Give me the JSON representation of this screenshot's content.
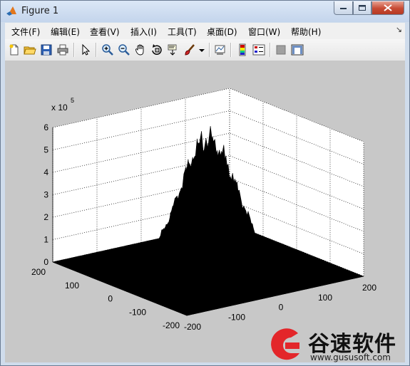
{
  "window": {
    "title": "Figure 1",
    "icon": "matlab-logo-icon"
  },
  "menu": {
    "items": [
      "文件(F)",
      "编辑(E)",
      "查看(V)",
      "插入(I)",
      "工具(T)",
      "桌面(D)",
      "窗口(W)",
      "帮助(H)"
    ],
    "overflow_icon": "menu-overflow-arrow-icon"
  },
  "toolbar": {
    "icons": [
      "new-figure-icon",
      "open-file-icon",
      "save-icon",
      "print-icon",
      "select-arrow-icon",
      "zoom-in-icon",
      "zoom-out-icon",
      "pan-hand-icon",
      "rotate-3d-icon",
      "data-cursor-icon",
      "brush-icon",
      "brush-dropdown-icon",
      "link-plot-icon",
      "colorbar-icon",
      "legend-icon",
      "hide-plot-tools-icon",
      "show-plot-tools-icon"
    ]
  },
  "chart_data": {
    "type": "surface-3d",
    "exponent_label": "x 10",
    "exponent_power": "5",
    "z_ticks": [
      "0",
      "1",
      "2",
      "3",
      "4",
      "5",
      "6"
    ],
    "zlim": [
      0,
      600000
    ],
    "x_ticks": [
      "-200",
      "-100",
      "0",
      "100",
      "200"
    ],
    "xlim": [
      -200,
      200
    ],
    "y_ticks": [
      "-200",
      "-100",
      "0",
      "100",
      "200"
    ],
    "ylim": [
      -200,
      200
    ],
    "grid": true,
    "surface_color": "#000000",
    "peak_value": 550000,
    "peak_location": [
      0,
      0
    ]
  },
  "colors": {
    "figure_background": "#c8c8c8",
    "axes_background": "#ffffff",
    "surface": "#000000"
  },
  "watermark": {
    "title": "谷速软件",
    "url": "www.gususoft.com"
  }
}
